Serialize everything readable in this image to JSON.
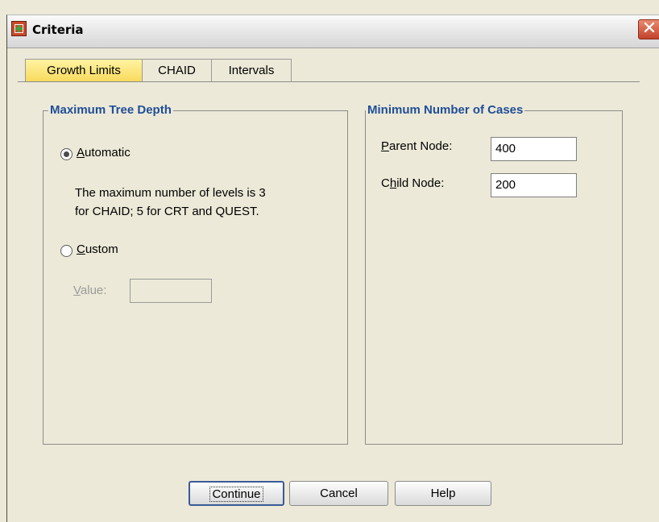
{
  "window": {
    "title": "Criteria"
  },
  "tabs": [
    {
      "label": "Growth Limits",
      "active": true
    },
    {
      "label": "CHAID",
      "active": false
    },
    {
      "label": "Intervals",
      "active": false
    }
  ],
  "max_tree_depth": {
    "title": "Maximum Tree Depth",
    "automatic_label": "Automatic",
    "automatic_selected": true,
    "description_line1": "The maximum number of levels is 3",
    "description_line2": "for CHAID; 5 for CRT and QUEST.",
    "custom_label": "Custom",
    "custom_selected": false,
    "value_label": "Value:",
    "value": ""
  },
  "min_cases": {
    "title": "Minimum Number of Cases",
    "parent_label": "Parent Node:",
    "parent_value": "400",
    "child_label": "Child Node:",
    "child_value": "200"
  },
  "buttons": {
    "continue": "Continue",
    "cancel": "Cancel",
    "help": "Help"
  },
  "colors": {
    "group_title": "#1f4e97",
    "active_tab": "#f8da5d",
    "background": "#ece9d8"
  }
}
